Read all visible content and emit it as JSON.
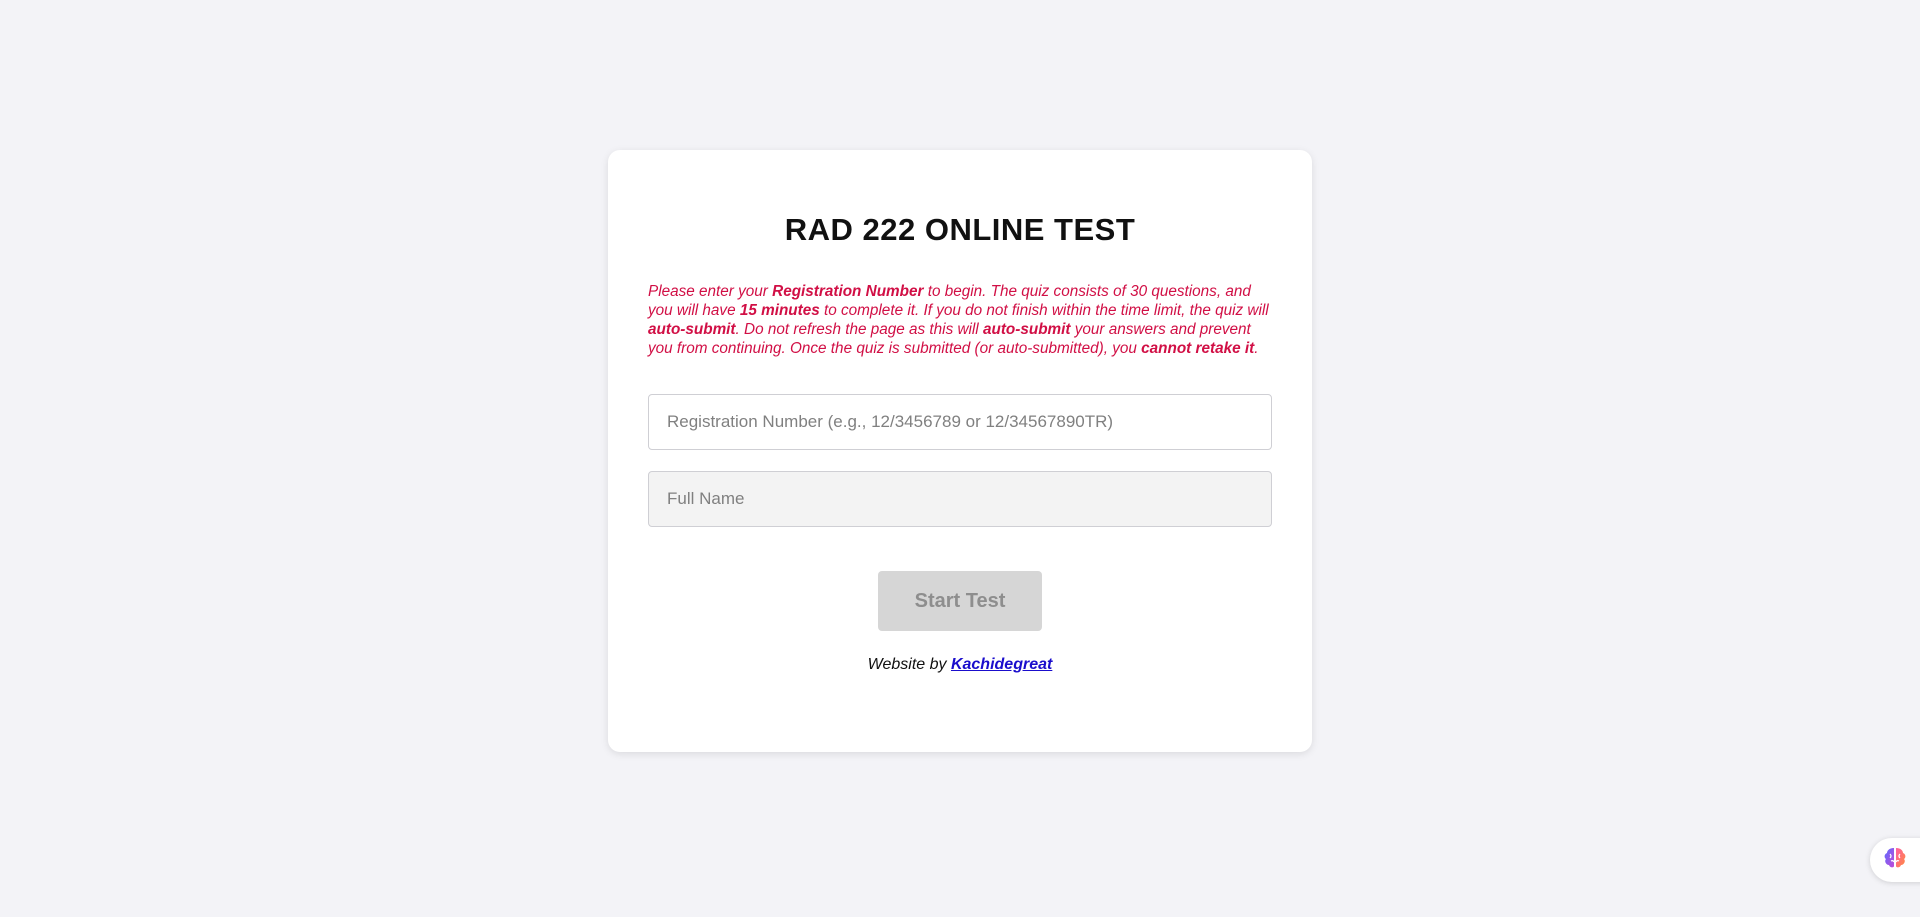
{
  "card": {
    "title": "RAD 222 ONLINE TEST",
    "notice": [
      {
        "text": "Please enter your ",
        "bold": false
      },
      {
        "text": "Registration Number",
        "bold": true
      },
      {
        "text": " to begin. The quiz consists of 30 questions, and you will have ",
        "bold": false
      },
      {
        "text": "15 minutes",
        "bold": true
      },
      {
        "text": " to complete it. If you do not finish within the time limit, the quiz will ",
        "bold": false
      },
      {
        "text": "auto-submit",
        "bold": true
      },
      {
        "text": ". Do not refresh the page as this will ",
        "bold": false
      },
      {
        "text": "auto-submit",
        "bold": true
      },
      {
        "text": " your answers and prevent you from continuing. Once the quiz is submitted (or auto-submitted), you ",
        "bold": false
      },
      {
        "text": "cannot retake it",
        "bold": true
      },
      {
        "text": ".",
        "bold": false
      }
    ],
    "registration_field": {
      "value": "",
      "placeholder": "Registration Number (e.g., 12/3456789 or 12/34567890TR)"
    },
    "name_field": {
      "value": "",
      "placeholder": "Full Name"
    },
    "start_button_label": "Start Test",
    "credit_prefix": "Website by ",
    "credit_link": "Kachidegreat"
  },
  "fab": {
    "icon": "brain-icon"
  },
  "colors": {
    "background": "#f3f3f7",
    "notice": "#d10f45",
    "link": "#1a0dcc",
    "button_disabled": "#d6d6d6"
  }
}
